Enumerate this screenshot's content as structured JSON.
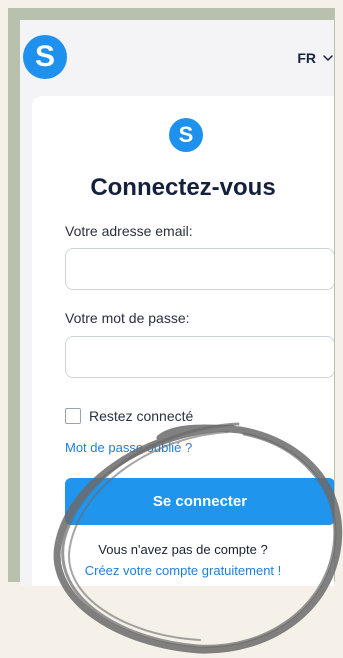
{
  "header": {
    "logo_letter": "S",
    "language": "FR"
  },
  "card": {
    "logo_letter": "S",
    "title": "Connectez-vous"
  },
  "form": {
    "email_label": "Votre adresse email:",
    "email_value": "",
    "password_label": "Votre mot de passe:",
    "password_value": "",
    "remember_label": "Restez connecté",
    "remember_checked": false,
    "forgot_link": "Mot de passe oublié ?",
    "submit_label": "Se connecter"
  },
  "signup": {
    "prompt": "Vous n'avez pas de compte ?",
    "link": "Créez votre compte gratuitement !"
  },
  "colors": {
    "brand": "#1e90ee",
    "frame": "#b7c1ad",
    "background": "#f5f1e9",
    "scribble": "#6b6b6b"
  }
}
